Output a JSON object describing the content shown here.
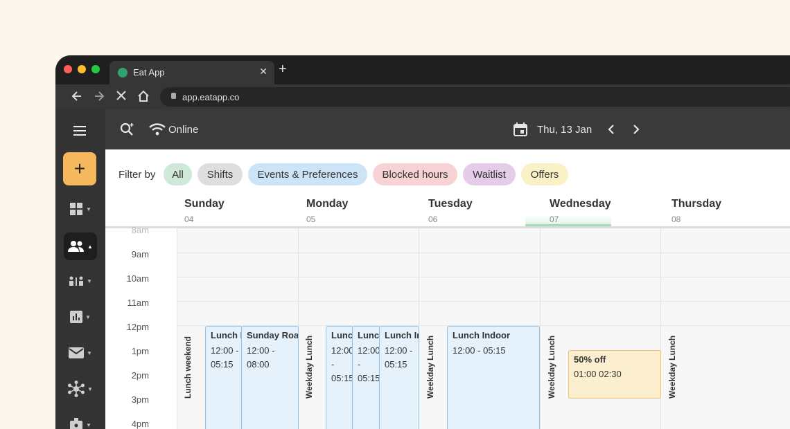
{
  "browser": {
    "tab_title": "Eat App",
    "tab_close": "✕",
    "new_tab": "+",
    "url": "app.eatapp.co"
  },
  "header": {
    "status": "Online",
    "date": "Thu, 13 Jan"
  },
  "sidebar": {
    "add_label": "+",
    "items": [
      {
        "icon": "dashboard-icon"
      },
      {
        "icon": "guests-icon",
        "active": true
      },
      {
        "icon": "staff-icon"
      },
      {
        "icon": "reports-icon"
      },
      {
        "icon": "mail-icon"
      },
      {
        "icon": "integrations-icon"
      },
      {
        "icon": "badge-icon"
      }
    ]
  },
  "filter": {
    "label": "Filter by",
    "chips": [
      {
        "label": "All",
        "color": "#cfe9d8"
      },
      {
        "label": "Shifts",
        "color": "#dedede"
      },
      {
        "label": "Events & Preferences",
        "color": "#cde4f7"
      },
      {
        "label": "Blocked hours",
        "color": "#f8d3d6"
      },
      {
        "label": "Waitlist",
        "color": "#e5cdea"
      },
      {
        "label": "Offers",
        "color": "#fbf1c7"
      }
    ]
  },
  "days": [
    {
      "name": "Sunday",
      "num": "04"
    },
    {
      "name": "Monday",
      "num": "05"
    },
    {
      "name": "Tuesday",
      "num": "06"
    },
    {
      "name": "Wednesday",
      "num": "07",
      "today": true
    },
    {
      "name": "Thursday",
      "num": "08"
    }
  ],
  "times": [
    "8am",
    "9am",
    "10am",
    "11am",
    "12pm",
    "1pm",
    "2pm",
    "3pm",
    "4pm"
  ],
  "shifts": [
    "Lunch weekend",
    "Weekday Lunch",
    "Weekday Lunch",
    "Weekday Lunch",
    "Weekday Lunch"
  ],
  "events": [
    {
      "title": "Lunch Indoor",
      "line1": "12:00 -",
      "line2": "05:15"
    },
    {
      "title": "Sunday Roast",
      "line1": "12:00 -",
      "line2": "08:00"
    },
    {
      "title": "Lunch Indoor",
      "line1": "12:00 -",
      "line2": "05:15"
    },
    {
      "title": "Lunch Indoor",
      "line1": "12:00 -",
      "line2": "05:15"
    },
    {
      "title": "Lunch Indoor",
      "line1": "12:00 -",
      "line2": "05:15"
    },
    {
      "title": "Lunch Indoor",
      "line1": "12:00 - 05:15",
      "line2": ""
    }
  ],
  "offer": {
    "title": "50% off",
    "time": "01:00 02:30"
  },
  "colors": {
    "accent": "#f6b85c",
    "today": "#2fa36b",
    "event": "#e5f1fb",
    "offer": "#fcefcf"
  }
}
